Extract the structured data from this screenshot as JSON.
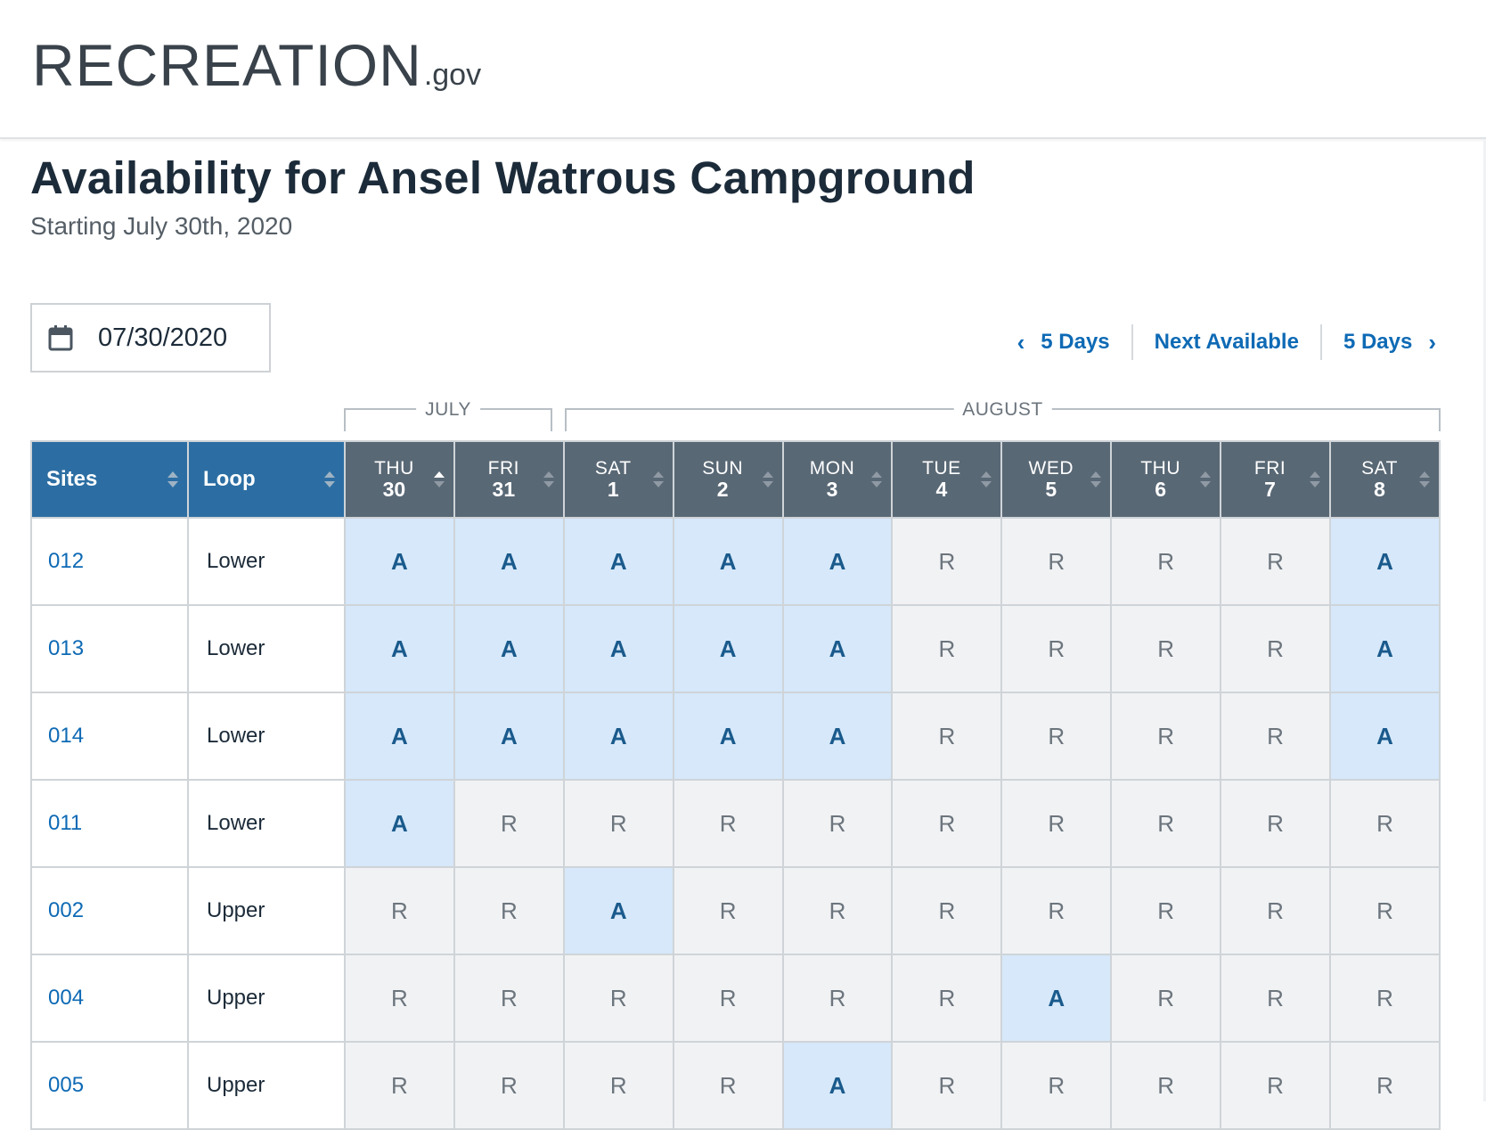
{
  "logo": {
    "main": "RECREATION",
    "gov": ".gov"
  },
  "page": {
    "title": "Availability for Ansel Watrous Campground",
    "subtitle": "Starting July 30th, 2020"
  },
  "date_picker": {
    "value": "07/30/2020",
    "icon": "calendar-icon"
  },
  "nav": {
    "prev_label": "5 Days",
    "next_available_label": "Next Available",
    "next_label": "5 Days"
  },
  "months": [
    "JULY",
    "AUGUST"
  ],
  "headers": {
    "sites": "Sites",
    "loop": "Loop"
  },
  "days": [
    {
      "dow": "THU",
      "num": "30"
    },
    {
      "dow": "FRI",
      "num": "31"
    },
    {
      "dow": "SAT",
      "num": "1"
    },
    {
      "dow": "SUN",
      "num": "2"
    },
    {
      "dow": "MON",
      "num": "3"
    },
    {
      "dow": "TUE",
      "num": "4"
    },
    {
      "dow": "WED",
      "num": "5"
    },
    {
      "dow": "THU",
      "num": "6"
    },
    {
      "dow": "FRI",
      "num": "7"
    },
    {
      "dow": "SAT",
      "num": "8"
    }
  ],
  "rows": [
    {
      "site": "012",
      "loop": "Lower",
      "cells": [
        "A",
        "A",
        "A",
        "A",
        "A",
        "R",
        "R",
        "R",
        "R",
        "A"
      ]
    },
    {
      "site": "013",
      "loop": "Lower",
      "cells": [
        "A",
        "A",
        "A",
        "A",
        "A",
        "R",
        "R",
        "R",
        "R",
        "A"
      ]
    },
    {
      "site": "014",
      "loop": "Lower",
      "cells": [
        "A",
        "A",
        "A",
        "A",
        "A",
        "R",
        "R",
        "R",
        "R",
        "A"
      ]
    },
    {
      "site": "011",
      "loop": "Lower",
      "cells": [
        "A",
        "R",
        "R",
        "R",
        "R",
        "R",
        "R",
        "R",
        "R",
        "R"
      ]
    },
    {
      "site": "002",
      "loop": "Upper",
      "cells": [
        "R",
        "R",
        "A",
        "R",
        "R",
        "R",
        "R",
        "R",
        "R",
        "R"
      ]
    },
    {
      "site": "004",
      "loop": "Upper",
      "cells": [
        "R",
        "R",
        "R",
        "R",
        "R",
        "R",
        "A",
        "R",
        "R",
        "R"
      ]
    },
    {
      "site": "005",
      "loop": "Upper",
      "cells": [
        "R",
        "R",
        "R",
        "R",
        "A",
        "R",
        "R",
        "R",
        "R",
        "R"
      ]
    }
  ],
  "colors": {
    "header_blue": "#2c6ea3",
    "header_gray": "#596875",
    "available_bg": "#d6e8fa",
    "reserved_bg": "#f1f2f4",
    "link": "#0e6ab5"
  }
}
